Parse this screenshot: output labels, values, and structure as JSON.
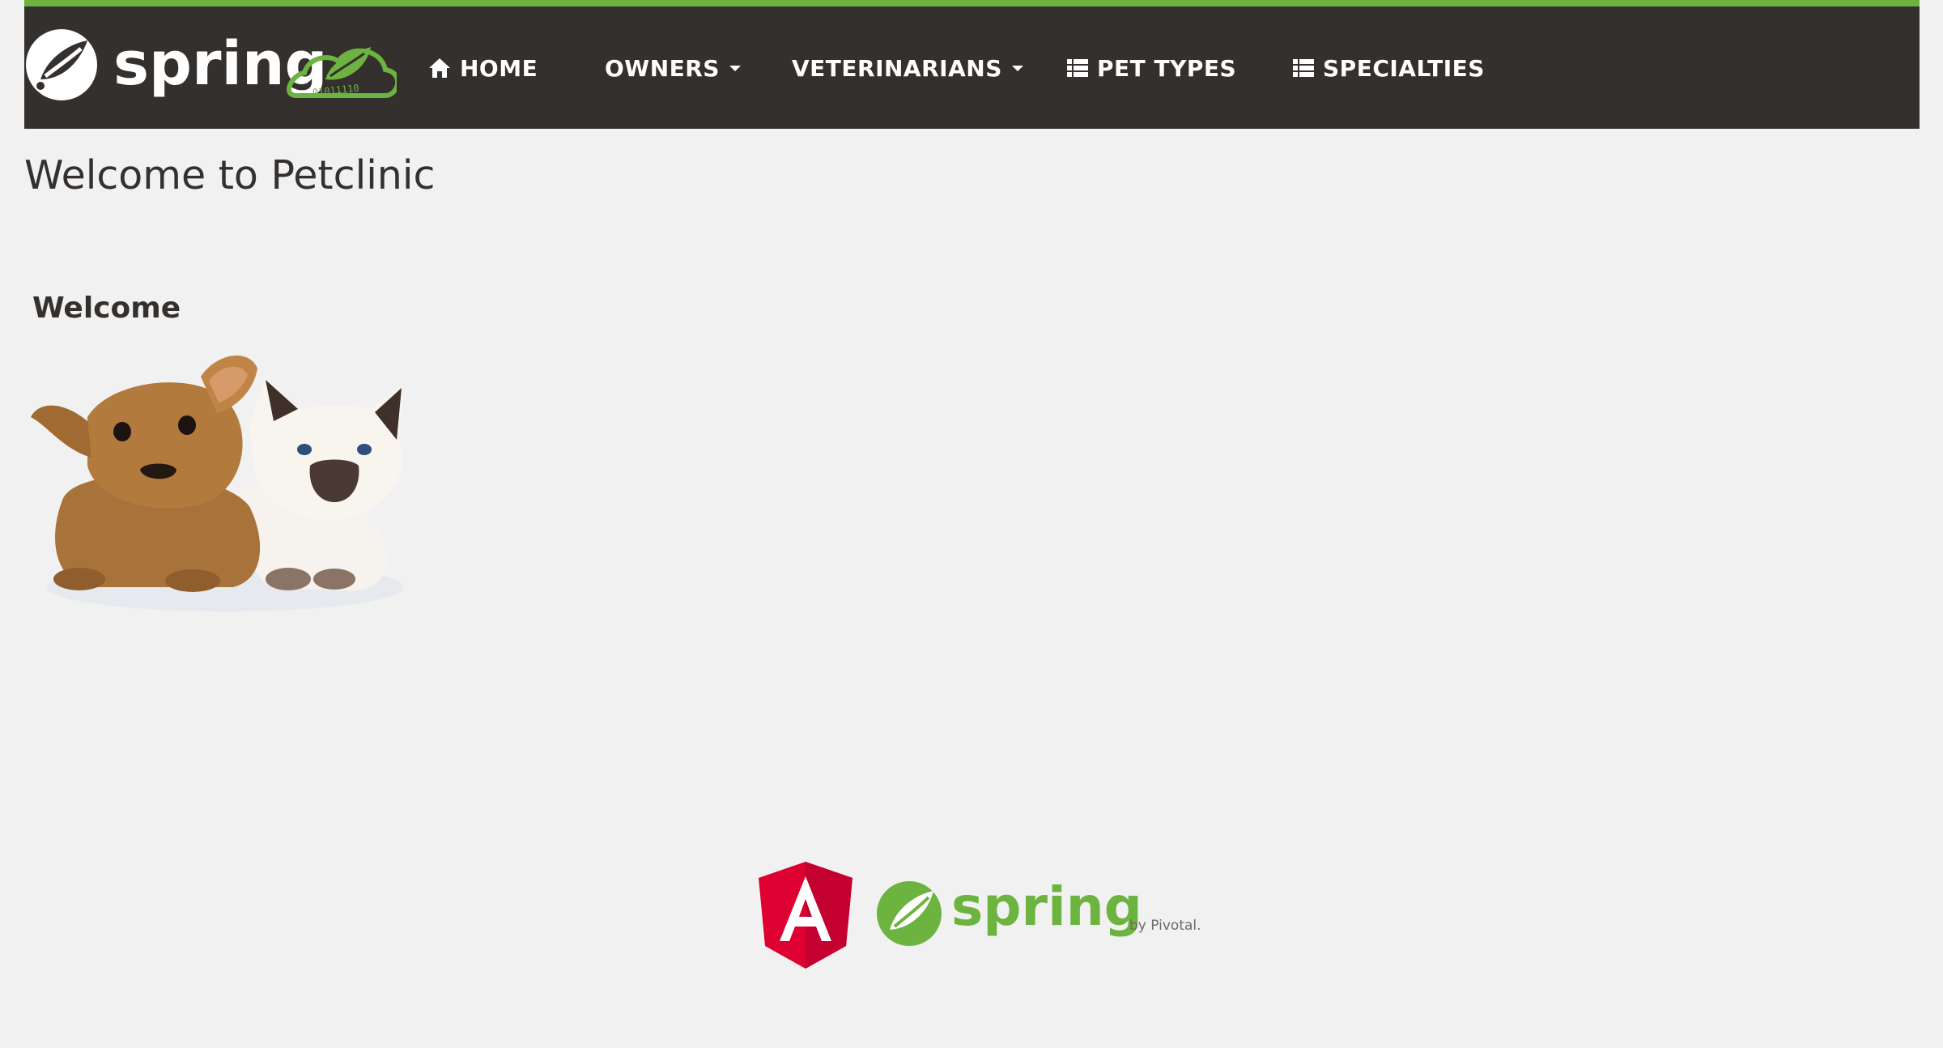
{
  "navbar": {
    "brand": {
      "logo_text": "spring",
      "leaf_badge_digits": "01011110",
      "logo_name": "spring-petclinic-logo"
    },
    "items": [
      {
        "label": "HOME",
        "icon": "home-icon",
        "has_dropdown": false
      },
      {
        "label": "OWNERS",
        "icon": null,
        "has_dropdown": true
      },
      {
        "label": "VETERINARIANS",
        "icon": null,
        "has_dropdown": true
      },
      {
        "label": "PET TYPES",
        "icon": "list-icon",
        "has_dropdown": false
      },
      {
        "label": "SPECIALTIES",
        "icon": "list-icon",
        "has_dropdown": false
      }
    ]
  },
  "main": {
    "title": "Welcome to Petclinic",
    "welcome_heading": "Welcome",
    "image_name": "puppy-and-kitten-image"
  },
  "footer": {
    "logos": [
      "angular-logo",
      "spring-by-pivotal-logo"
    ],
    "spring_text": "spring",
    "pivotal_text": "by Pivotal."
  },
  "colors": {
    "navbar_bg": "#34302d",
    "navbar_top_border": "#6db33f",
    "page_bg": "#f1f1f1",
    "text": "#34302d",
    "spring_green": "#6db33f",
    "angular_red": "#dd0031"
  }
}
